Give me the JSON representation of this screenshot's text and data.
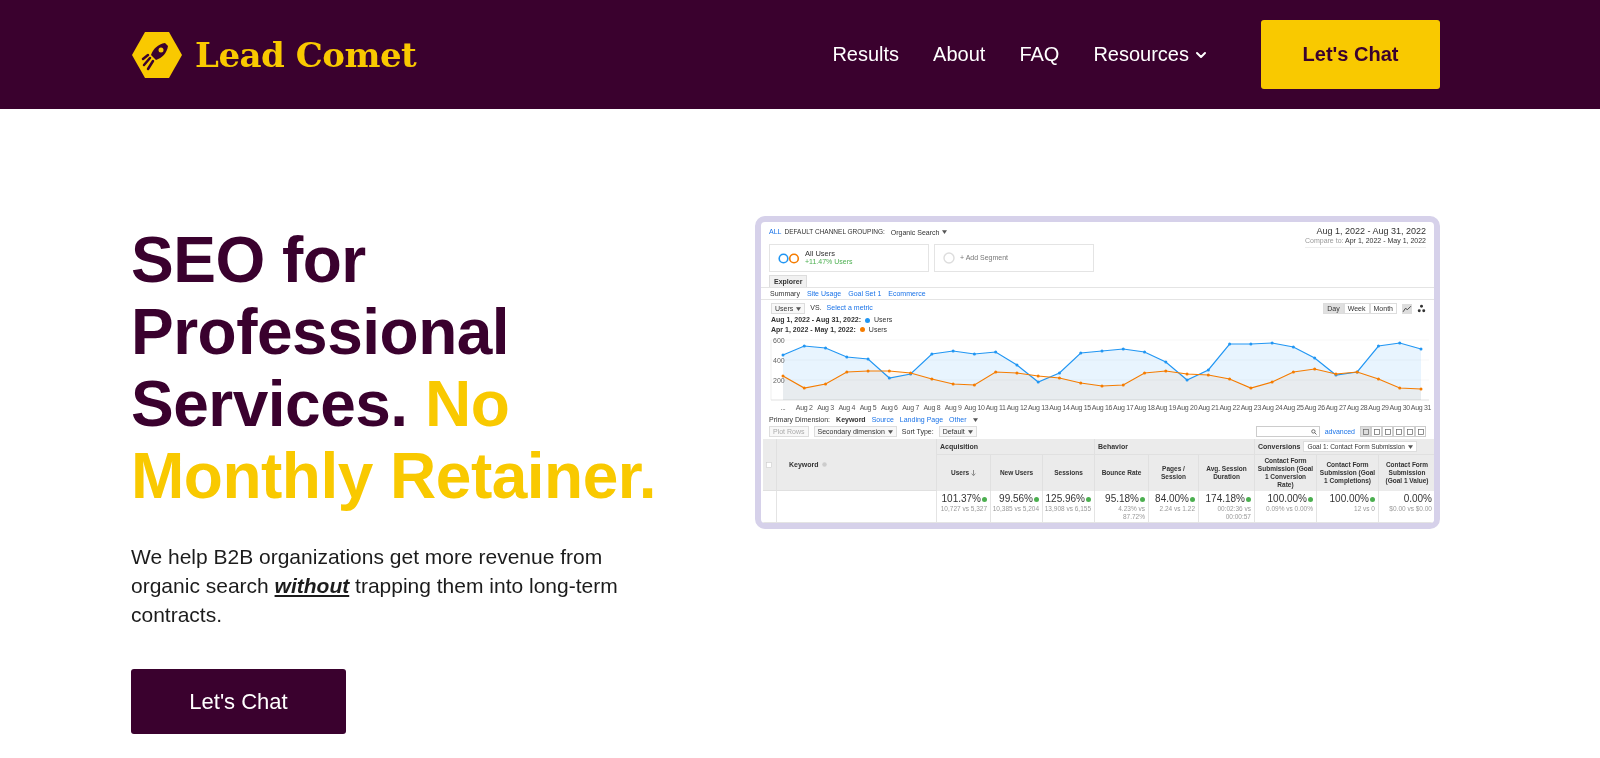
{
  "header": {
    "logo": "Lead Comet",
    "nav": [
      {
        "label": "Results",
        "kind": "link"
      },
      {
        "label": "About",
        "kind": "link"
      },
      {
        "label": "FAQ",
        "kind": "link"
      },
      {
        "label": "Resources",
        "kind": "dropdown"
      }
    ],
    "cta": "Let's Chat"
  },
  "hero": {
    "title": [
      {
        "text": "SEO for Professional Services.",
        "kind": "dark"
      },
      {
        "text": "No Monthly Retainer.",
        "kind": "accent"
      }
    ],
    "description": "We help B2B organizations get more revenue from organic search **without** trapping them into long-term contracts.",
    "cta": "Let's Chat"
  },
  "analytics": {
    "breadcrumb": {
      "root": "ALL",
      "path": "DEFAULT CHANNEL GROUPING:",
      "value": "Organic Search"
    },
    "date_range": {
      "current": "Aug 1, 2022 - Aug 31, 2022",
      "compare_label": "Compare to:",
      "compare": "Apr 1, 2022 - May 1, 2022"
    },
    "segments": [
      {
        "kind": "segment",
        "title": "All Users",
        "subtitle": "+11.47% Users"
      },
      {
        "kind": "add",
        "title": "+ Add Segment"
      }
    ],
    "tabs": [
      {
        "label": "Explorer",
        "selected": true
      }
    ],
    "subtabs": [
      {
        "label": "Summary",
        "selected": true
      },
      {
        "label": "Site Usage",
        "selected": false
      },
      {
        "label": "Goal Set 1",
        "selected": false
      },
      {
        "label": "Ecommerce",
        "selected": false
      }
    ],
    "metric": {
      "value": "Users",
      "vs": "VS.",
      "link": "Select a metric"
    },
    "periods": [
      {
        "label": "Day",
        "selected": true
      },
      {
        "label": "Week",
        "selected": false
      },
      {
        "label": "Month",
        "selected": false
      }
    ],
    "legend": [
      "Aug 1, 2022 - Aug 31, 2022:",
      "Apr 1, 2022 - May 1, 2022:"
    ],
    "chart_data": {
      "type": "area",
      "categories": [
        "...",
        "Aug 2",
        "Aug 3",
        "Aug 4",
        "Aug 5",
        "Aug 6",
        "Aug 7",
        "Aug 8",
        "Aug 9",
        "Aug 10",
        "Aug 11",
        "Aug 12",
        "Aug 13",
        "Aug 14",
        "Aug 15",
        "Aug 16",
        "Aug 17",
        "Aug 18",
        "Aug 19",
        "Aug 20",
        "Aug 21",
        "Aug 22",
        "Aug 23",
        "Aug 24",
        "Aug 25",
        "Aug 26",
        "Aug 27",
        "Aug 28",
        "Aug 29",
        "Aug 30",
        "Aug 31"
      ],
      "series": [
        {
          "name": "Users",
          "color": "#2196f3",
          "values": [
            450,
            540,
            520,
            430,
            410,
            220,
            260,
            460,
            490,
            460,
            480,
            350,
            180,
            270,
            470,
            490,
            510,
            480,
            380,
            200,
            300,
            560,
            560,
            570,
            530,
            420,
            250,
            280,
            540,
            570,
            510
          ]
        },
        {
          "name": "Users",
          "color": "#f57c00",
          "values": [
            240,
            120,
            160,
            280,
            290,
            290,
            270,
            210,
            160,
            150,
            280,
            270,
            240,
            220,
            170,
            140,
            150,
            270,
            290,
            260,
            250,
            210,
            120,
            180,
            280,
            310,
            260,
            280,
            210,
            120,
            110
          ]
        }
      ],
      "ylim": [
        0,
        600
      ],
      "yticks": [
        200,
        400,
        600
      ]
    },
    "dimensions": {
      "label": "Primary Dimension:",
      "items": [
        {
          "label": "Keyword",
          "selected": true
        },
        {
          "label": "Source",
          "selected": false
        },
        {
          "label": "Landing Page",
          "selected": false
        },
        {
          "label": "Other",
          "selected": false
        }
      ]
    },
    "toolbar": {
      "plot_rows": "Plot Rows",
      "secondary": "Secondary dimension",
      "sort_label": "Sort Type:",
      "sort": "Default",
      "advanced": "advanced",
      "views": [
        {
          "selected": true
        },
        {
          "selected": false
        },
        {
          "selected": false
        },
        {
          "selected": false
        },
        {
          "selected": false
        },
        {
          "selected": false
        }
      ]
    },
    "table": {
      "checkbox": {
        "checked": false
      },
      "keyword": "Keyword",
      "groups": [
        {
          "label": "Acquisition",
          "columns": [
            {
              "label": "Users",
              "sorted": true
            },
            {
              "label": "New Users",
              "sorted": false
            },
            {
              "label": "Sessions",
              "sorted": false
            }
          ]
        },
        {
          "label": "Behavior",
          "columns": [
            {
              "label": "Bounce Rate",
              "sorted": false
            },
            {
              "label": "Pages / Session",
              "sorted": false
            },
            {
              "label": "Avg. Session Duration",
              "sorted": false
            }
          ]
        },
        {
          "label": "Conversions",
          "selector": "Goal 1: Contact Form Submission",
          "columns": [
            {
              "label": "Contact Form Submission (Goal 1 Conversion Rate)",
              "sorted": false
            },
            {
              "label": "Contact Form Submission (Goal 1 Completions)",
              "sorted": false
            },
            {
              "label": "Contact Form Submission (Goal 1 Value)",
              "sorted": false
            }
          ]
        }
      ],
      "totals": [
        {
          "value": "101.37%",
          "compare": "10,727 vs 5,327",
          "up": true
        },
        {
          "value": "99.56%",
          "compare": "10,385 vs 5,204",
          "up": true
        },
        {
          "value": "125.96%",
          "compare": "13,908 vs 6,155",
          "up": true
        },
        {
          "value": "95.18%",
          "compare": "4.23% vs 87.72%",
          "up": true
        },
        {
          "value": "84.00%",
          "compare": "2.24 vs 1.22",
          "up": true
        },
        {
          "value": "174.18%",
          "compare": "00:02:36 vs 00:00:57",
          "up": true
        },
        {
          "value": "100.00%",
          "compare": "0.09% vs 0.00%",
          "up": true
        },
        {
          "value": "100.00%",
          "compare": "12 vs 0",
          "up": true
        },
        {
          "value": "0.00%",
          "compare": "$0.00 vs $0.00",
          "up": false
        }
      ]
    }
  }
}
